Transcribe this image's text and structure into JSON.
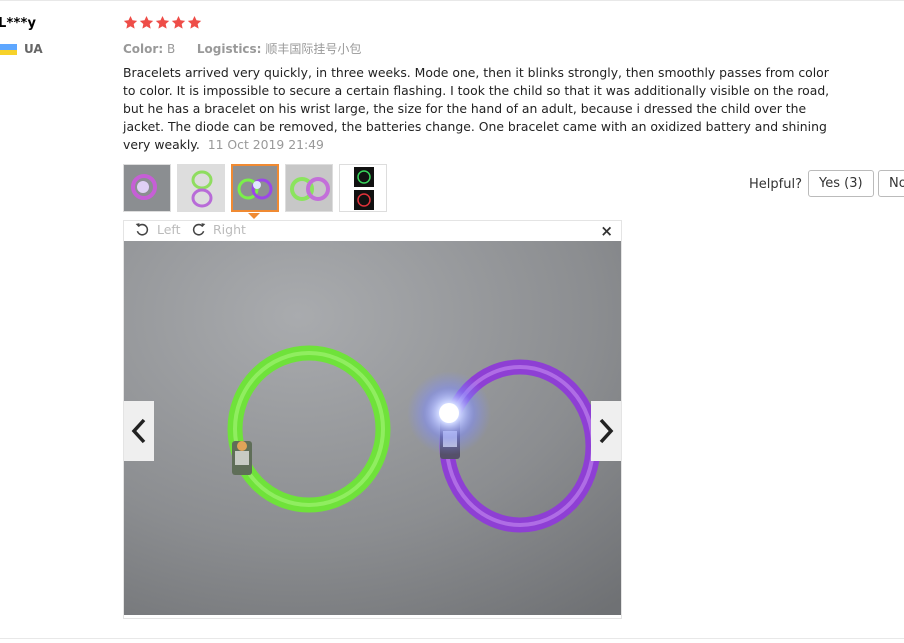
{
  "reviewer": {
    "name": "L***y",
    "country": "UA"
  },
  "rating": {
    "stars": 5,
    "color": "#ee4d48"
  },
  "meta": {
    "color_label": "Color:",
    "color_value": "B",
    "logistics_label": "Logistics:",
    "logistics_value": "顺丰国际挂号小包"
  },
  "review": {
    "text": "Bracelets arrived very quickly, in three weeks. Mode one, then it blinks strongly, then smoothly passes from color to color. It is impossible to secure a certain flashing. I took the child so that it was additionally visible on the road, but he has a bracelet on his wrist large, the size for the hand of an adult, because i dressed the child over the jacket. The diode can be removed, the batteries change. One bracelet came with an oxidized battery and shining very weakly.",
    "date": "11 Oct 2019 21:49"
  },
  "thumbnails": {
    "count": 5,
    "active_index": 2
  },
  "helpful": {
    "label": "Helpful?",
    "yes": "Yes (3)",
    "no": "No"
  },
  "viewer": {
    "rotate_left": "Left",
    "rotate_right": "Right",
    "close": "×"
  },
  "icons": [
    "rotate-left-icon",
    "rotate-right-icon",
    "close-icon",
    "chevron-left-icon",
    "chevron-right-icon",
    "star-icon",
    "flag-icon"
  ],
  "colors": {
    "accent": "#f08a32",
    "star": "#ee4d48",
    "muted": "#999999"
  }
}
